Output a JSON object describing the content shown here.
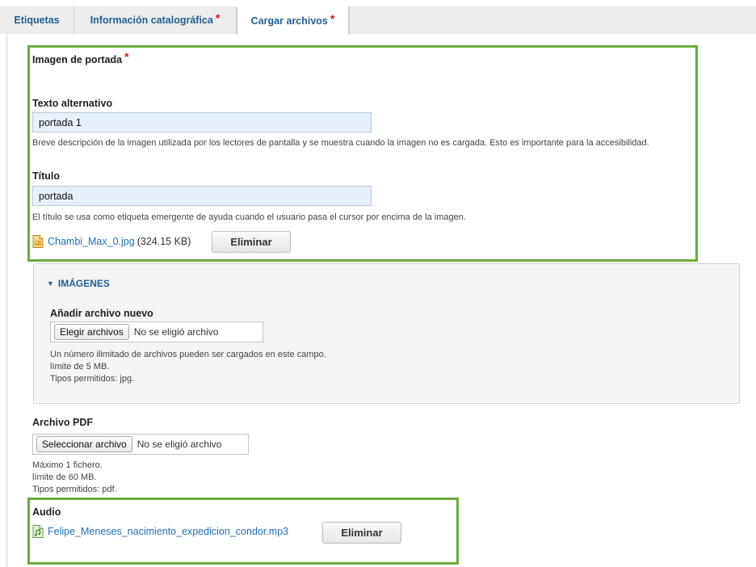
{
  "tabs": [
    {
      "label": "Etiquetas",
      "required": false
    },
    {
      "label": "Información catalográfica",
      "required": true
    },
    {
      "label": "Cargar archivos",
      "required": true,
      "active": true
    }
  ],
  "required_marker": "*",
  "cover_image": {
    "title": "Imagen de portada",
    "alt_label": "Texto alternativo",
    "alt_value": "portada 1",
    "alt_help": "Breve descripción de la imagen utilizada por los lectores de pantalla y se muestra cuando la imagen no es cargada. Esto es importante para la accesibilidad.",
    "title_label": "Título",
    "title_value": "portada",
    "title_help": "El título se usa como etiqueta emergente de ayuda cuando el usuario pasa el cursor por encima de la imagen.",
    "file_name": "Chambi_Max_0.jpg",
    "file_size": "(324.15 KB)",
    "remove_label": "Eliminar"
  },
  "images": {
    "legend": "IMÁGENES",
    "add_label": "Añadir archivo nuevo",
    "choose_button": "Elegir archivos",
    "no_file": "No se eligió archivo",
    "help_lines": [
      "Un número ilimitado de archivos pueden ser cargados en este campo.",
      "límite de 5 MB.",
      "Tipos permitidos: jpg."
    ]
  },
  "pdf": {
    "label": "Archivo PDF",
    "choose_button": "Seleccionar archivo",
    "no_file": "No se eligió archivo",
    "help_lines": [
      "Máximo 1 fichero.",
      "límite de 60 MB.",
      "Tipos permitidos: pdf."
    ]
  },
  "audio": {
    "label": "Audio",
    "file_name": "Felipe_Meneses_nacimiento_expedicion_condor.mp3",
    "remove_label": "Eliminar"
  },
  "colors": {
    "accent_link": "#1f6fb8",
    "highlight_border": "#6cab3c",
    "required": "#d21a1a",
    "autofill_bg": "#e8f0fe"
  }
}
